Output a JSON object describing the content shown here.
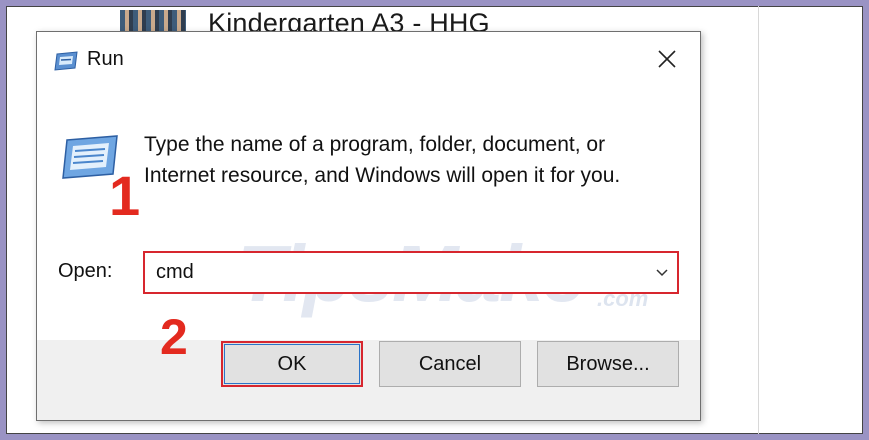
{
  "background": {
    "window_title": "Kindergarten A3 - HHG"
  },
  "dialog": {
    "title": "Run",
    "description": "Type the name of a program, folder, document, or Internet resource, and Windows will open it for you.",
    "open_label": "Open:",
    "open_value": "cmd",
    "buttons": {
      "ok": "OK",
      "cancel": "Cancel",
      "browse": "Browse..."
    }
  },
  "annotations": {
    "step1": "1",
    "step2": "2",
    "watermark": "TipsMake",
    "watermark_suffix": ".com"
  },
  "colors": {
    "highlight": "#d7262e",
    "step_number": "#e32a1f",
    "focus_blue": "#2a73c8"
  },
  "icons": [
    "run-icon",
    "close-icon",
    "run-program-icon",
    "chevron-down-icon"
  ]
}
